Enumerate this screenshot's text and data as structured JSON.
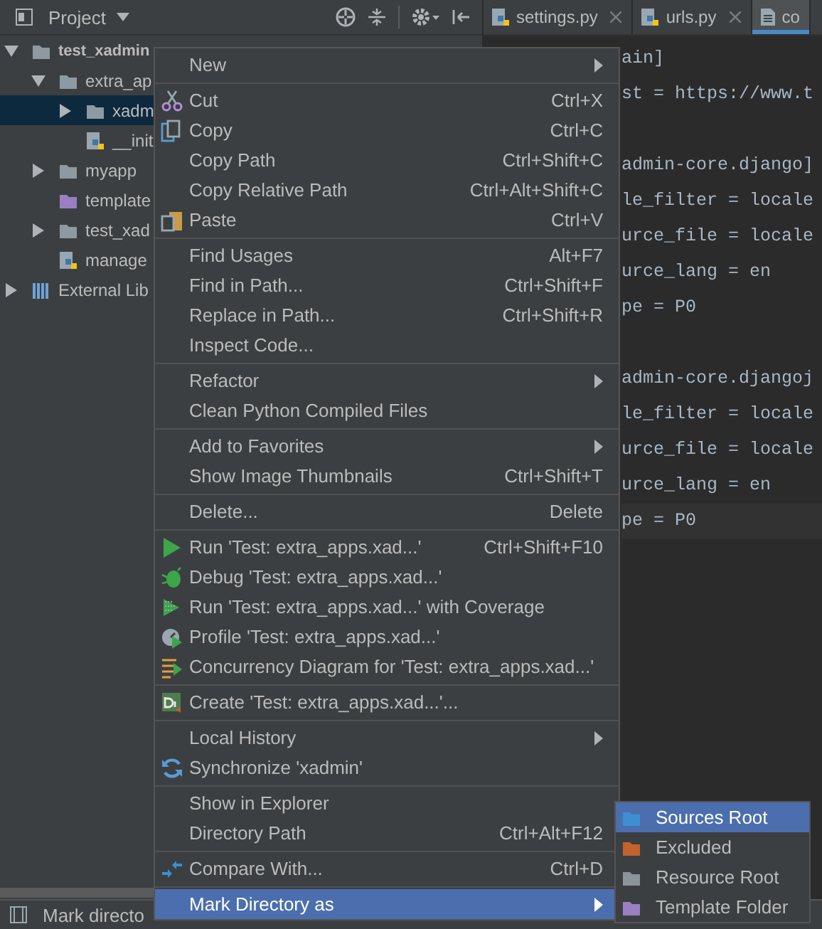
{
  "project_panel": {
    "title": "Project",
    "tree": [
      {
        "label": "test_xadmin",
        "kind": "project",
        "expanded": true,
        "selected": false,
        "children": [
          {
            "label": "extra_ap",
            "kind": "folder",
            "expanded": true,
            "selected": false,
            "children": [
              {
                "label": "xadm",
                "kind": "folder",
                "expanded": false,
                "selected": true
              },
              {
                "label": "__init",
                "kind": "python_file",
                "selected": false
              }
            ]
          },
          {
            "label": "myapp",
            "kind": "folder",
            "expanded": false,
            "selected": false
          },
          {
            "label": "template",
            "kind": "template_folder",
            "selected": false
          },
          {
            "label": "test_xad",
            "kind": "folder",
            "expanded": false,
            "selected": false
          },
          {
            "label": "manage",
            "kind": "python_file",
            "selected": false
          }
        ]
      },
      {
        "label": "External Lib",
        "kind": "library",
        "expanded": false,
        "selected": false
      }
    ]
  },
  "editor": {
    "tabs": [
      {
        "label": "settings.py",
        "kind": "python",
        "selected": false,
        "closable": true
      },
      {
        "label": "urls.py",
        "kind": "python",
        "selected": false,
        "closable": true
      },
      {
        "label": "co",
        "kind": "text",
        "selected": true,
        "closable": false
      }
    ],
    "lines": [
      {
        "text": "ain]",
        "current": false
      },
      {
        "text": "st = https://www.t",
        "current": false
      },
      {
        "text": "admin-core.django]",
        "current": false,
        "blank_line_before": true
      },
      {
        "text": "le_filter = locale",
        "current": false
      },
      {
        "text": "urce_file = locale",
        "current": false
      },
      {
        "text": "urce_lang = en",
        "current": false
      },
      {
        "text": "pe = P0",
        "current": false
      },
      {
        "text": "admin-core.djangoj",
        "current": false,
        "blank_line_before": true
      },
      {
        "text": "le_filter = locale",
        "current": false
      },
      {
        "text": "urce_file = locale",
        "current": false
      },
      {
        "text": "urce_lang = en",
        "current": false
      },
      {
        "text": "pe = P0",
        "current": true
      }
    ]
  },
  "context_menu": [
    {
      "kind": "item",
      "label": "New",
      "submenu": true,
      "selected": false
    },
    {
      "kind": "separator"
    },
    {
      "kind": "item",
      "label": "Cut",
      "shortcut": "Ctrl+X",
      "submenu": false,
      "selected": false
    },
    {
      "kind": "item",
      "label": "Copy",
      "shortcut": "Ctrl+C",
      "submenu": false,
      "selected": false
    },
    {
      "kind": "item",
      "label": "Copy Path",
      "shortcut": "Ctrl+Shift+C",
      "submenu": false,
      "selected": false
    },
    {
      "kind": "item",
      "label": "Copy Relative Path",
      "shortcut": "Ctrl+Alt+Shift+C",
      "submenu": false,
      "selected": false
    },
    {
      "kind": "item",
      "label": "Paste",
      "shortcut": "Ctrl+V",
      "submenu": false,
      "selected": false
    },
    {
      "kind": "separator"
    },
    {
      "kind": "item",
      "label": "Find Usages",
      "shortcut": "Alt+F7",
      "submenu": false,
      "selected": false
    },
    {
      "kind": "item",
      "label": "Find in Path...",
      "shortcut": "Ctrl+Shift+F",
      "submenu": false,
      "selected": false
    },
    {
      "kind": "item",
      "label": "Replace in Path...",
      "shortcut": "Ctrl+Shift+R",
      "submenu": false,
      "selected": false
    },
    {
      "kind": "item",
      "label": "Inspect Code...",
      "submenu": false,
      "selected": false
    },
    {
      "kind": "separator"
    },
    {
      "kind": "item",
      "label": "Refactor",
      "submenu": true,
      "selected": false
    },
    {
      "kind": "item",
      "label": "Clean Python Compiled Files",
      "submenu": false,
      "selected": false
    },
    {
      "kind": "separator"
    },
    {
      "kind": "item",
      "label": "Add to Favorites",
      "submenu": true,
      "selected": false
    },
    {
      "kind": "item",
      "label": "Show Image Thumbnails",
      "shortcut": "Ctrl+Shift+T",
      "submenu": false,
      "selected": false
    },
    {
      "kind": "separator"
    },
    {
      "kind": "item",
      "label": "Delete...",
      "shortcut": "Delete",
      "submenu": false,
      "selected": false
    },
    {
      "kind": "separator"
    },
    {
      "kind": "item",
      "label": "Run 'Test: extra_apps.xad...'",
      "shortcut": "Ctrl+Shift+F10",
      "submenu": false,
      "selected": false
    },
    {
      "kind": "item",
      "label": "Debug 'Test: extra_apps.xad...'",
      "submenu": false,
      "selected": false
    },
    {
      "kind": "item",
      "label": "Run 'Test: extra_apps.xad...' with Coverage",
      "submenu": false,
      "selected": false
    },
    {
      "kind": "item",
      "label": "Profile 'Test: extra_apps.xad...'",
      "submenu": false,
      "selected": false
    },
    {
      "kind": "item",
      "label": "Concurrency Diagram for 'Test: extra_apps.xad...'",
      "submenu": false,
      "selected": false
    },
    {
      "kind": "separator"
    },
    {
      "kind": "item",
      "label": "Create 'Test: extra_apps.xad...'...",
      "submenu": false,
      "selected": false
    },
    {
      "kind": "separator"
    },
    {
      "kind": "item",
      "label": "Local History",
      "submenu": true,
      "selected": false
    },
    {
      "kind": "item",
      "label": "Synchronize 'xadmin'",
      "submenu": false,
      "selected": false
    },
    {
      "kind": "separator"
    },
    {
      "kind": "item",
      "label": "Show in Explorer",
      "submenu": false,
      "selected": false
    },
    {
      "kind": "item",
      "label": "Directory Path",
      "shortcut": "Ctrl+Alt+F12",
      "submenu": false,
      "selected": false
    },
    {
      "kind": "separator"
    },
    {
      "kind": "item",
      "label": "Compare With...",
      "shortcut": "Ctrl+D",
      "submenu": false,
      "selected": false
    },
    {
      "kind": "separator"
    },
    {
      "kind": "item",
      "label": "Mark Directory as",
      "submenu": true,
      "selected": true
    }
  ],
  "submenu": [
    {
      "label": "Sources Root",
      "color": "#3d8fd1",
      "selected": true
    },
    {
      "label": "Excluded",
      "color": "#c4622c",
      "selected": false
    },
    {
      "label": "Resource Root",
      "color": "#8a9499",
      "selected": false
    },
    {
      "label": "Template Folder",
      "color": "#9a7fc2",
      "selected": false
    }
  ],
  "status_bar": {
    "text": "Mark directo"
  }
}
